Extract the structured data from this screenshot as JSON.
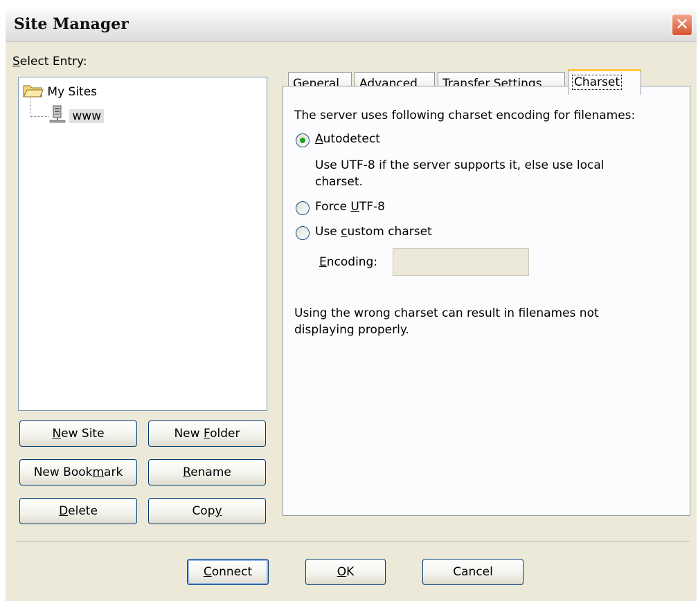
{
  "window": {
    "title": "Site Manager",
    "close_glyph": "✕"
  },
  "left": {
    "select_label_ul": "S",
    "select_label_rest": "elect Entry:",
    "tree": [
      {
        "label": "My Sites",
        "icon": "folder-icon"
      },
      {
        "label": "www",
        "icon": "server-icon"
      }
    ]
  },
  "buttons": {
    "new_site": {
      "pre": "",
      "ul": "N",
      "post": "ew Site"
    },
    "new_folder": {
      "pre": "New ",
      "ul": "F",
      "post": "older"
    },
    "new_bookmark": {
      "pre": "New Book",
      "ul": "m",
      "post": "ark"
    },
    "rename": {
      "pre": "",
      "ul": "R",
      "post": "ename"
    },
    "delete": {
      "pre": "",
      "ul": "D",
      "post": "elete"
    },
    "copy": {
      "pre": "Cop",
      "ul": "y",
      "post": ""
    }
  },
  "tabs": [
    "General",
    "Advanced",
    "Transfer Settings",
    "Charset"
  ],
  "charset": {
    "intro": "The server uses following charset encoding for filenames:",
    "autodetect": {
      "pre": "",
      "ul": "A",
      "post": "utodetect"
    },
    "autodetect_desc_1": "Use UTF-8 if the server supports it, else use local",
    "autodetect_desc_2": "charset.",
    "force_utf8": {
      "pre": "Force ",
      "ul": "U",
      "post": "TF-8"
    },
    "custom": {
      "pre": "Use ",
      "ul": "c",
      "post": "ustom charset"
    },
    "encoding_label": {
      "pre": "",
      "ul": "E",
      "post": "ncoding:"
    },
    "encoding_value": "",
    "warning_1": "Using the wrong charset can result in filenames not",
    "warning_2": "displaying properly.",
    "selected": "autodetect"
  },
  "footer": {
    "connect": {
      "pre": "",
      "ul": "C",
      "post": "onnect"
    },
    "ok": {
      "pre": "",
      "ul": "O",
      "post": "K"
    },
    "cancel": "Cancel"
  },
  "colors": {
    "accent": "#ffc83c",
    "radio_dot": "#21a121",
    "close": "#d8502e"
  }
}
